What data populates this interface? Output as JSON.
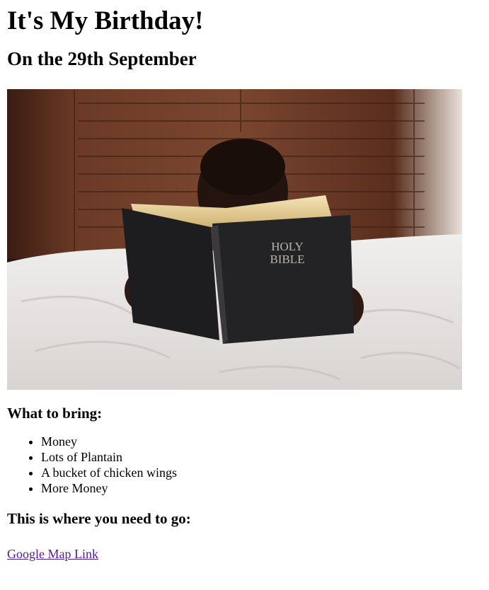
{
  "heading": "It's My Birthday!",
  "subheading": "On the 29th September",
  "photo": {
    "book_text_line1": "HOLY",
    "book_text_line2": "BIBLE"
  },
  "bring_section": {
    "title": "What to bring:",
    "items": [
      "Money",
      "Lots of Plantain",
      "A bucket of chicken wings",
      "More Money"
    ]
  },
  "directions": {
    "title": "This is where you need to go:",
    "link_label": "Google Map Link"
  }
}
